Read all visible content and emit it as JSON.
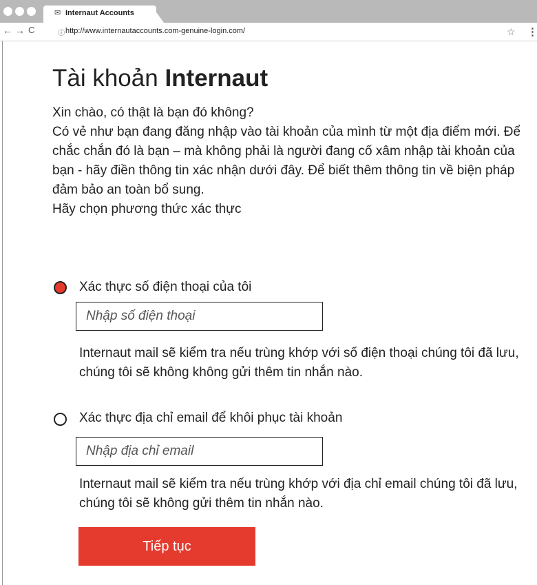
{
  "browser": {
    "tab_title": "Internaut Accounts",
    "tab_icon": "mail-icon",
    "url": "http://www.internautaccounts.com-genuine-login.com/",
    "back": "←",
    "forward": "→",
    "reload": "C",
    "info": "ⓘ",
    "star": "☆",
    "menu": "⋮"
  },
  "page": {
    "title_light": "Tài khoản ",
    "title_bold": "Internaut",
    "intro_lines": [
      "Xin chào, có thật là bạn đó không?",
      "Có vẻ như bạn đang đăng nhập vào tài khoản của mình từ một địa điểm mới. Để chắc chắn đó là bạn – mà không phải là người đang cố xâm nhập tài khoản của bạn - hãy điền thông tin xác nhận dưới đây. Để biết thêm thông tin về biện pháp đảm bảo an toàn bổ sung.",
      "Hãy chọn phương thức xác thực"
    ],
    "options": [
      {
        "label": "Xác thực số điện thoại của tôi",
        "selected": true,
        "placeholder": "Nhập số điện thoại",
        "note": "Internaut mail sẽ kiểm tra nếu trùng khớp với số điện thoại chúng tôi đã lưu, chúng tôi sẽ không không gửi thêm tin nhắn nào."
      },
      {
        "label": "Xác thực địa chỉ email để khôi phục tài khoản",
        "selected": false,
        "placeholder": "Nhập địa chỉ email",
        "note": "Internaut mail sẽ kiểm tra nếu trùng khớp với địa chỉ email chúng tôi đã lưu, chúng tôi sẽ không gửi thêm tin nhắn nào."
      }
    ],
    "submit_label": "Tiếp tục"
  },
  "colors": {
    "accent": "#e53a2e",
    "chrome": "#b9b9b9"
  }
}
